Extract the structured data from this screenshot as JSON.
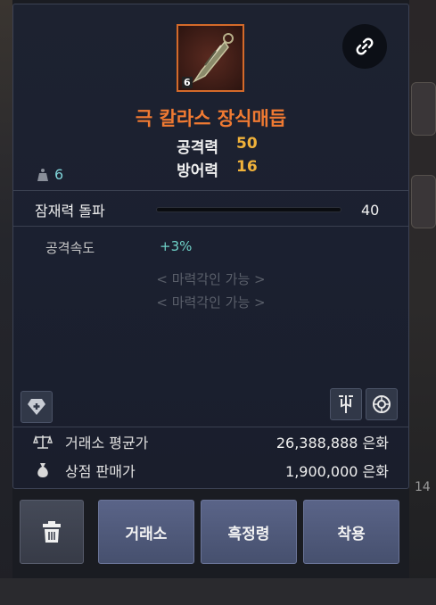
{
  "item": {
    "name": "극 칼라스 장식매듭",
    "grade_badge": "6",
    "icon": "ornament-knot-icon"
  },
  "stats": [
    {
      "label": "공격력",
      "value": "50"
    },
    {
      "label": "방어력",
      "value": "16"
    }
  ],
  "weight": {
    "value": "6",
    "icon": "weight-icon"
  },
  "potential": {
    "label": "잠재력 돌파",
    "value": "40",
    "fill": 1.0
  },
  "options": {
    "attack_speed_label": "공격속도",
    "attack_speed_value": "+3%",
    "engrave_1": "< 마력각인 가능 >",
    "engrave_2": "< 마력각인 가능 >"
  },
  "prices": [
    {
      "icon": "scale-icon",
      "label": "거래소 평균가",
      "value": "26,388,888 은화"
    },
    {
      "icon": "money-bag-icon",
      "label": "상점 판매가",
      "value": "1,900,000 은화"
    }
  ],
  "buttons": {
    "trash_icon": "trash-icon",
    "market": "거래소",
    "black_spirit": "흑정령",
    "equip": "착용"
  },
  "side": {
    "number": "14"
  },
  "colors": {
    "item_name": "#f07a32",
    "stat_value": "#f0b23a",
    "positive": "#6fd2c8",
    "button": "#505a7c"
  }
}
